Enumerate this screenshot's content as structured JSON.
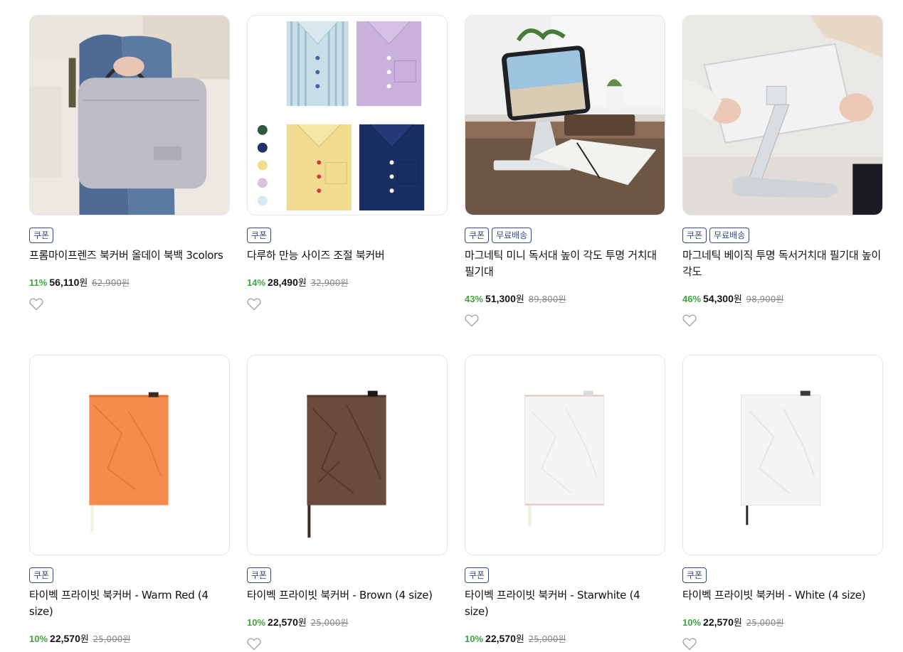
{
  "products": [
    {
      "badges": [
        "쿠폰"
      ],
      "title": "프롬마이프렌즈 북커버 올데이 북백 3colors",
      "discount": "11%",
      "price": "56,110",
      "won": "원",
      "original": "62,900원",
      "icon": "heart-icon"
    },
    {
      "badges": [
        "쿠폰"
      ],
      "title": "다루하 만능 사이즈 조절 북커버",
      "discount": "14%",
      "price": "28,490",
      "won": "원",
      "original": "32,900원",
      "icon": "heart-icon"
    },
    {
      "badges": [
        "쿠폰",
        "무료배송"
      ],
      "title": "마그네틱 미니 독서대 높이 각도 투명 거치대 필기대",
      "discount": "43%",
      "price": "51,300",
      "won": "원",
      "original": "89,800원",
      "icon": "heart-icon"
    },
    {
      "badges": [
        "쿠폰",
        "무료배송"
      ],
      "title": "마그네틱 베이직 투명 독서거치대 필기대 높이 각도",
      "discount": "46%",
      "price": "54,300",
      "won": "원",
      "original": "98,900원",
      "icon": "heart-icon"
    },
    {
      "badges": [
        "쿠폰"
      ],
      "title": "타이벡 프라이빗 북커버 - Warm Red (4 size)",
      "discount": "10%",
      "price": "22,570",
      "won": "원",
      "original": "25,000원",
      "icon": "heart-icon"
    },
    {
      "badges": [
        "쿠폰"
      ],
      "title": "타이벡 프라이빗 북커버 - Brown (4 size)",
      "discount": "10%",
      "price": "22,570",
      "won": "원",
      "original": "25,000원",
      "icon": "heart-icon"
    },
    {
      "badges": [
        "쿠폰"
      ],
      "title": "타이벡 프라이빗 북커버 - Starwhite (4 size)",
      "discount": "10%",
      "price": "22,570",
      "won": "원",
      "original": "25,000원",
      "icon": "heart-icon"
    },
    {
      "badges": [
        "쿠폰"
      ],
      "title": "타이벡 프라이빗 북커버 - White (4 size)",
      "discount": "10%",
      "price": "22,570",
      "won": "원",
      "original": "25,000원",
      "icon": "heart-icon"
    }
  ],
  "colors": {
    "badge": "#3b4a82",
    "discount": "#3fa53f"
  }
}
